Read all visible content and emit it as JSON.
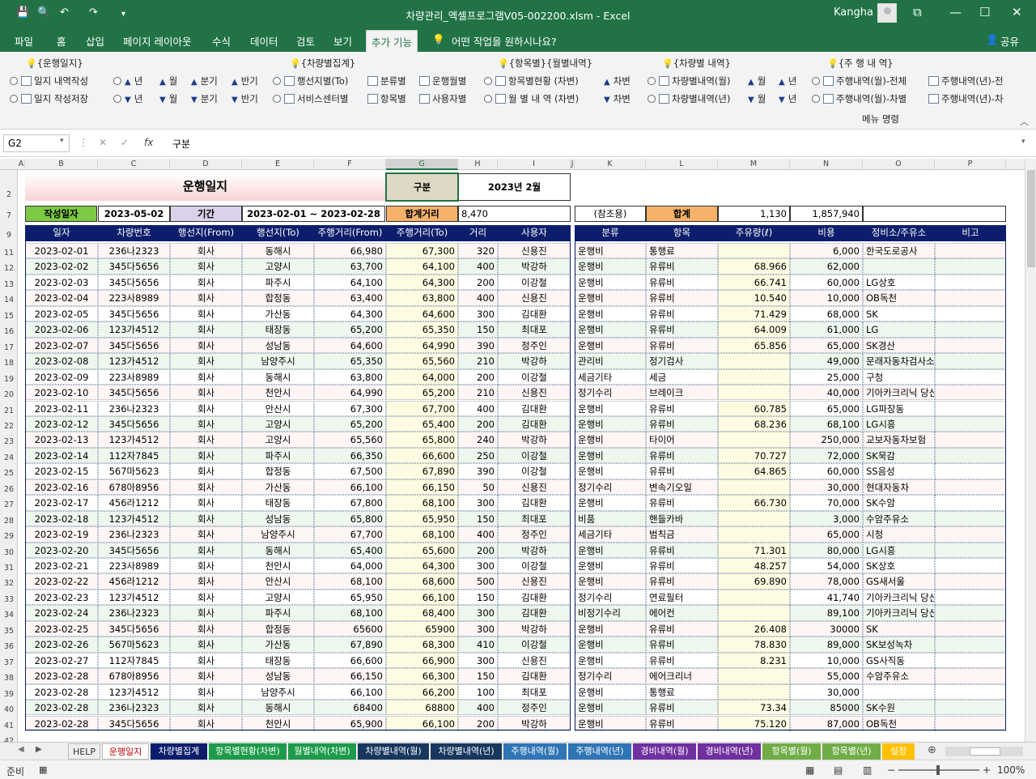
{
  "window": {
    "title": "차량관리_엑셀프로그램V05-002200.xlsm  -  Excel",
    "user": "Kangha"
  },
  "ribbon_tabs": [
    "파일",
    "홈",
    "삽입",
    "페이지 레이아웃",
    "수식",
    "데이터",
    "검토",
    "보기",
    "추가 기능"
  ],
  "tell_me": "어떤 작업을 원하시나요?",
  "share": "공유",
  "groups": [
    "{운행일지}",
    "{차량별집계}",
    "{항목별}{월별내역}",
    "{차량별 내역}",
    "{주 행 내 역}"
  ],
  "controls": [
    [
      "일지 내역작성",
      "년",
      "월",
      "분기",
      "반기",
      "행선지별(To)",
      "분류별",
      "운행월별",
      "항목별현황 (차변)",
      "차변",
      "차량별내역(월)",
      "월",
      "년",
      "주행내역(월)-전체",
      "주행내역(년)-전"
    ],
    [
      "일지 작성저장",
      "년",
      "월",
      "분기",
      "반기",
      "서비스센터별",
      "항목별",
      "사용자별",
      "월 별 내 역 (차변)",
      "차변",
      "차량별내역(년)",
      "월",
      "년",
      "주행내역(월)-차별",
      "주행내역(년)-차"
    ]
  ],
  "menu_label": "메뉴 명령",
  "namebox": "G2",
  "formula": "구분",
  "colors": {
    "excel_green": "#217346",
    "header_navy": "#0c1e6b",
    "pink": "#f8d4d4",
    "label_green": "#7cc943",
    "orange": "#f6b26b",
    "lavender": "#d9d2e9",
    "tan": "#ddd9c4"
  },
  "columns": [
    "A",
    "B",
    "C",
    "D",
    "E",
    "F",
    "G",
    "H",
    "I",
    "J",
    "K",
    "L",
    "M",
    "N",
    "O",
    "P"
  ],
  "row_numbers": [
    "2",
    "7",
    "9",
    "11",
    "12",
    "13",
    "14",
    "15",
    "16",
    "17",
    "18",
    "19",
    "20",
    "21",
    "22",
    "23",
    "24",
    "25",
    "26",
    "27",
    "28",
    "29",
    "30",
    "31",
    "32",
    "33",
    "34",
    "35",
    "36",
    "37",
    "38",
    "39",
    "40",
    "41",
    "42"
  ],
  "title": "운행일지",
  "gubun_label": "구분",
  "month": "2023년 2월",
  "write_label": "작성일자",
  "write_date": "2023-05-02",
  "period_label": "기간",
  "period": "2023-02-01  ~ 2023-02-28",
  "sum_dist_label": "합계거리",
  "sum_dist": "8,470",
  "ref_label": "(참조용)",
  "sum_label": "합계",
  "sum_fuel": "1,130",
  "sum_cost": "1,857,940",
  "left_headers": [
    "일자",
    "차량번호",
    "행선지(From)",
    "행선지(To)",
    "주행거리(From)",
    "주행거리(To)",
    "거리",
    "사용자"
  ],
  "right_headers": [
    "분류",
    "항목",
    "주유량(ℓ)",
    "비용",
    "정비소/주유소",
    "비고"
  ],
  "rows": [
    [
      "2023-02-01",
      "236나2323",
      "회사",
      "동해시",
      "66,980",
      "67,300",
      "320",
      "신용진",
      "운행비",
      "통행료",
      "",
      "6,000",
      "한국도로공사"
    ],
    [
      "2023-02-02",
      "345다5656",
      "회사",
      "고양시",
      "63,700",
      "64,100",
      "400",
      "박강하",
      "운행비",
      "유류비",
      "68.966",
      "62,000",
      ""
    ],
    [
      "2023-02-03",
      "345다5656",
      "회사",
      "파주시",
      "64,100",
      "64,300",
      "200",
      "이강철",
      "운행비",
      "유류비",
      "66.741",
      "60,000",
      "LG상호"
    ],
    [
      "2023-02-04",
      "223사8989",
      "회사",
      "합정동",
      "63,400",
      "63,800",
      "400",
      "신용진",
      "운행비",
      "유류비",
      "10.540",
      "10,000",
      "OB독천"
    ],
    [
      "2023-02-05",
      "345다5656",
      "회사",
      "가산동",
      "64,300",
      "64,600",
      "300",
      "김대환",
      "운행비",
      "유류비",
      "71.429",
      "68,000",
      "SK"
    ],
    [
      "2023-02-06",
      "123가4512",
      "회사",
      "태장동",
      "65,200",
      "65,350",
      "150",
      "최대포",
      "운행비",
      "유류비",
      "64.009",
      "61,000",
      "LG"
    ],
    [
      "2023-02-07",
      "345다5656",
      "회사",
      "성남동",
      "64,600",
      "64,990",
      "390",
      "정주인",
      "운행비",
      "유류비",
      "65.856",
      "65,000",
      "SK경산"
    ],
    [
      "2023-02-08",
      "123가4512",
      "회사",
      "남양주시",
      "65,350",
      "65,560",
      "210",
      "박강하",
      "관리비",
      "정기검사",
      "",
      "49,000",
      "문래자동차검사소"
    ],
    [
      "2023-02-09",
      "223사8989",
      "회사",
      "동해시",
      "63,800",
      "64,000",
      "200",
      "이강철",
      "세금기타",
      "세금",
      "",
      "25,000",
      "구청"
    ],
    [
      "2023-02-10",
      "345다5656",
      "회사",
      "천안시",
      "64,990",
      "65,200",
      "210",
      "신용진",
      "정기수리",
      "브레이크",
      "",
      "40,000",
      "기아카크리닉 당산점"
    ],
    [
      "2023-02-11",
      "236나2323",
      "회사",
      "안산시",
      "67,300",
      "67,700",
      "400",
      "김대환",
      "운행비",
      "유류비",
      "60.785",
      "65,000",
      "LG파장동"
    ],
    [
      "2023-02-12",
      "345다5656",
      "회사",
      "고양시",
      "65,200",
      "65,400",
      "200",
      "김대환",
      "운행비",
      "유류비",
      "68.236",
      "68,100",
      "LG시흥"
    ],
    [
      "2023-02-13",
      "123가4512",
      "회사",
      "고양시",
      "65,560",
      "65,800",
      "240",
      "박강하",
      "운행비",
      "타이어",
      "",
      "250,000",
      "교보자동차보험"
    ],
    [
      "2023-02-14",
      "112자7845",
      "회사",
      "파주시",
      "66,350",
      "66,600",
      "250",
      "이강철",
      "운행비",
      "유류비",
      "70.727",
      "72,000",
      "SK묵감"
    ],
    [
      "2023-02-15",
      "567마5623",
      "회사",
      "합정동",
      "67,500",
      "67,890",
      "390",
      "이강철",
      "운행비",
      "유류비",
      "64.865",
      "60,000",
      "SS음성"
    ],
    [
      "2023-02-16",
      "678아8956",
      "회사",
      "가산동",
      "66,100",
      "66,150",
      "50",
      "신용진",
      "정기수리",
      "변속기오일",
      "",
      "30,000",
      "현대자동차"
    ],
    [
      "2023-02-17",
      "456라1212",
      "회사",
      "태장동",
      "67,800",
      "68,100",
      "300",
      "김대환",
      "운행비",
      "유류비",
      "66.730",
      "70,000",
      "SK수암"
    ],
    [
      "2023-02-18",
      "123가4512",
      "회사",
      "성남동",
      "65,800",
      "65,950",
      "150",
      "최대포",
      "비품",
      "핸들카바",
      "",
      "3,000",
      "수암주유소"
    ],
    [
      "2023-02-19",
      "236나2323",
      "회사",
      "남양주시",
      "67,700",
      "68,100",
      "400",
      "정주인",
      "세금기타",
      "범칙금",
      "",
      "65,000",
      "시청"
    ],
    [
      "2023-02-20",
      "345다5656",
      "회사",
      "동해시",
      "65,400",
      "65,600",
      "200",
      "박강하",
      "운행비",
      "유류비",
      "71.301",
      "80,000",
      "LG시흥"
    ],
    [
      "2023-02-21",
      "223사8989",
      "회사",
      "천안시",
      "64,000",
      "64,300",
      "300",
      "이강철",
      "운행비",
      "유류비",
      "48.257",
      "54,000",
      "SK상호"
    ],
    [
      "2023-02-22",
      "456라1212",
      "회사",
      "안산시",
      "68,100",
      "68,600",
      "500",
      "신용진",
      "운행비",
      "유류비",
      "69.890",
      "78,000",
      "GS새서울"
    ],
    [
      "2023-02-23",
      "123가4512",
      "회사",
      "고양시",
      "65,950",
      "66,100",
      "150",
      "김대환",
      "정기수리",
      "연료필터",
      "",
      "41,740",
      "기아카크리닉 당산점"
    ],
    [
      "2023-02-24",
      "236나2323",
      "회사",
      "파주시",
      "68,100",
      "68,400",
      "300",
      "김대환",
      "비정기수리",
      "에어컨",
      "",
      "89,100",
      "기아카크리닉 당산점"
    ],
    [
      "2023-02-25",
      "345다5656",
      "회사",
      "합정동",
      "65600",
      "65900",
      "300",
      "박강하",
      "운행비",
      "유류비",
      "26.408",
      "30000",
      "SK"
    ],
    [
      "2023-02-26",
      "567마5623",
      "회사",
      "가산동",
      "67,890",
      "68,300",
      "410",
      "이강철",
      "운행비",
      "유류비",
      "78.830",
      "89,000",
      "SK보성녹차"
    ],
    [
      "2023-02-27",
      "112자7845",
      "회사",
      "태장동",
      "66,600",
      "66,900",
      "300",
      "신용진",
      "운행비",
      "유류비",
      "8.231",
      "10,000",
      "GS사직동"
    ],
    [
      "2023-02-28",
      "678아8956",
      "회사",
      "성남동",
      "66,150",
      "66,300",
      "150",
      "김대환",
      "정기수리",
      "에어크리너",
      "",
      "55,000",
      "수암주유소"
    ],
    [
      "2023-02-28",
      "123가4512",
      "회사",
      "남양주시",
      "66,100",
      "66,200",
      "100",
      "최대포",
      "운행비",
      "통행료",
      "",
      "30,000",
      ""
    ],
    [
      "2023-02-28",
      "236나2323",
      "회사",
      "동해시",
      "68400",
      "68800",
      "400",
      "정주인",
      "운행비",
      "유류비",
      "73.34",
      "85000",
      "SK수원"
    ],
    [
      "2023-02-28",
      "345다5656",
      "회사",
      "천안시",
      "65,900",
      "66,100",
      "200",
      "박강하",
      "운행비",
      "유류비",
      "75.120",
      "87,000",
      "OB독천"
    ]
  ],
  "sheet_tabs": [
    {
      "label": "HELP",
      "color": "#efefef",
      "fg": "#333"
    },
    {
      "label": "운행일지",
      "color": "#ffffff",
      "fg": "#c00000"
    },
    {
      "label": "차량별집계",
      "color": "#0c1e6b",
      "fg": "#ffffff"
    },
    {
      "label": "항목별현황(차변)",
      "color": "#1e9b4a",
      "fg": "#ffffff"
    },
    {
      "label": "월별내역(차변)",
      "color": "#1e9b4a",
      "fg": "#ffffff"
    },
    {
      "label": "차량별내역(월)",
      "color": "#17375e",
      "fg": "#ffffff"
    },
    {
      "label": "차량별내역(년)",
      "color": "#17375e",
      "fg": "#ffffff"
    },
    {
      "label": "주행내역(월)",
      "color": "#2f75b5",
      "fg": "#ffffff"
    },
    {
      "label": "주행내역(년)",
      "color": "#2f75b5",
      "fg": "#ffffff"
    },
    {
      "label": "경비내역(월)",
      "color": "#7030a0",
      "fg": "#ffffff"
    },
    {
      "label": "경비내역(년)",
      "color": "#7030a0",
      "fg": "#ffffff"
    },
    {
      "label": "항목별(월)",
      "color": "#70ad47",
      "fg": "#ffffff"
    },
    {
      "label": "항목별(년)",
      "color": "#70ad47",
      "fg": "#ffffff"
    },
    {
      "label": "설정",
      "color": "#ffc000",
      "fg": "#ffffff"
    }
  ],
  "status": {
    "ready": "준비",
    "zoom": "100%"
  }
}
